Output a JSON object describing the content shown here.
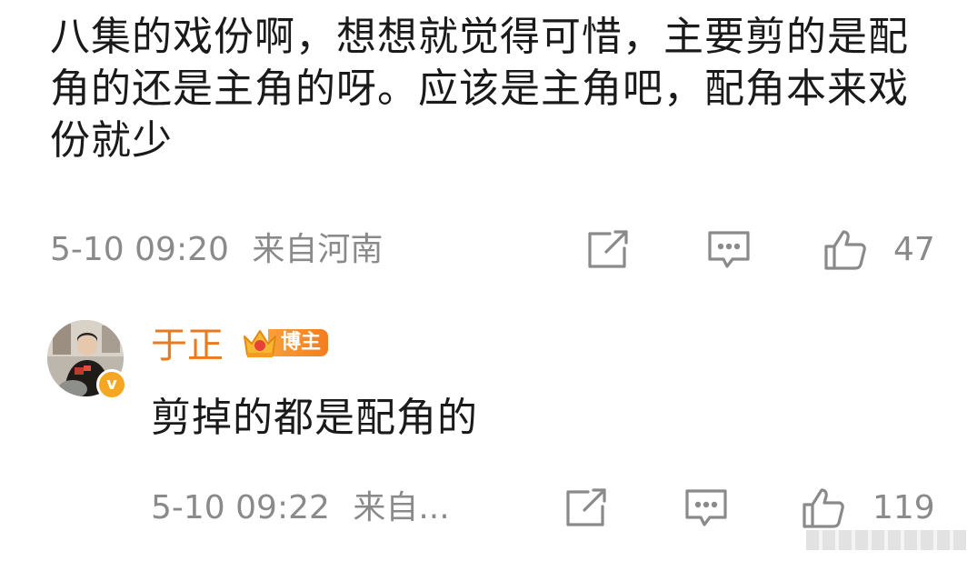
{
  "comment": {
    "text": "八集的戏份啊，想想就觉得可惜，主要剪的是配角的还是主角的呀。应该是主角吧，配角本来戏份就少",
    "time": "5-10 09:20",
    "location": "来自河南",
    "like_count": "47"
  },
  "reply": {
    "author_name": "于正",
    "badge_label": "博主",
    "verified_mark": "v",
    "text": "剪掉的都是配角的",
    "time": "5-10 09:22",
    "location": "来自...",
    "like_count": "119"
  },
  "icons": {
    "share": "share-icon",
    "comment": "comment-icon",
    "like": "thumbs-up-icon",
    "crown": "crown-icon"
  },
  "colors": {
    "text": "#1a1a1a",
    "meta": "#8a8a8a",
    "username": "#ea7a1e",
    "badge": "#f47d1f"
  }
}
